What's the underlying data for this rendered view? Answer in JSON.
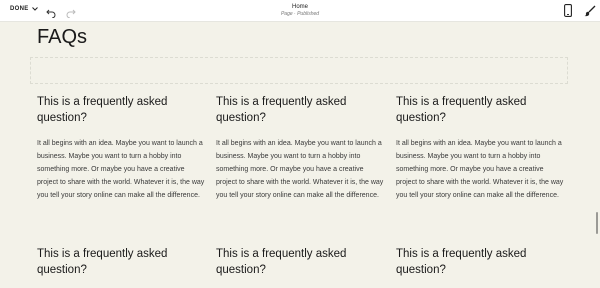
{
  "toolbar": {
    "done_label": "DONE",
    "page_title": "Home",
    "page_status": "Page · Published"
  },
  "content": {
    "heading": "FAQs",
    "items": [
      {
        "question": "This is a frequently asked question?",
        "answer": "It all begins with an idea. Maybe you want to launch a business. Maybe you want to turn a hobby into something more. Or maybe you have a creative project to share with the world. Whatever it is, the way you tell your story online can make all the difference."
      },
      {
        "question": "This is a frequently asked question?",
        "answer": "It all begins with an idea. Maybe you want to launch a business. Maybe you want to turn a hobby into something more. Or maybe you have a creative project to share with the world. Whatever it is, the way you tell your story online can make all the difference."
      },
      {
        "question": "This is a frequently asked question?",
        "answer": "It all begins with an idea. Maybe you want to launch a business. Maybe you want to turn a hobby into something more. Or maybe you have a creative project to share with the world. Whatever it is, the way you tell your story online can make all the difference."
      },
      {
        "question": "This is a frequently asked question?"
      },
      {
        "question": "This is a frequently asked question?"
      },
      {
        "question": "This is a frequently asked question?"
      }
    ]
  },
  "colors": {
    "background": "#f3f2e9",
    "toolbar": "#ffffff",
    "text": "#1a1a1a"
  },
  "icons": [
    "chevron-down-icon",
    "undo-icon",
    "redo-icon",
    "mobile-icon",
    "design-brush-icon"
  ]
}
